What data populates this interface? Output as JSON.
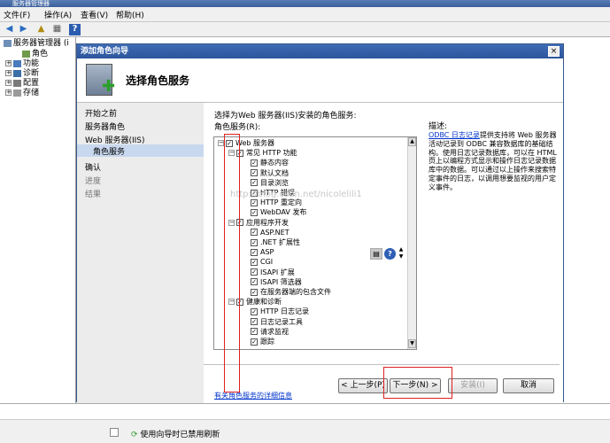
{
  "window": {
    "title": "服务器管理器"
  },
  "menu": [
    "文件(F)",
    "操作(A)",
    "查看(V)",
    "帮助(H)"
  ],
  "left_tree": {
    "root": "服务器管理器 (i",
    "items": [
      "角色",
      "功能",
      "诊断",
      "配置",
      "存储"
    ]
  },
  "dialog": {
    "title": "添加角色向导",
    "close": "×",
    "header": "选择角色服务",
    "nav": [
      "开始之前",
      "服务器角色",
      "Web 服务器(IIS)",
      "角色服务",
      "确认",
      "进度",
      "结果"
    ],
    "instruction": "选择为Web 服务器(IIS)安装的角色服务:",
    "tree_label": "角色服务(R):",
    "tree": [
      {
        "label": "Web 服务器",
        "level": 0,
        "expand": "⊟"
      },
      {
        "label": "常见 HTTP 功能",
        "level": 1,
        "expand": "⊟"
      },
      {
        "label": "静态内容",
        "level": 2
      },
      {
        "label": "默认文档",
        "level": 2
      },
      {
        "label": "目录浏览",
        "level": 2
      },
      {
        "label": "HTTP 错误",
        "level": 2
      },
      {
        "label": "HTTP 重定向",
        "level": 2
      },
      {
        "label": "WebDAV 发布",
        "level": 2
      },
      {
        "label": "应用程序开发",
        "level": 1,
        "expand": "⊟"
      },
      {
        "label": "ASP.NET",
        "level": 2
      },
      {
        "label": ".NET 扩展性",
        "level": 2
      },
      {
        "label": "ASP",
        "level": 2
      },
      {
        "label": "CGI",
        "level": 2
      },
      {
        "label": "ISAPI 扩展",
        "level": 2
      },
      {
        "label": "ISAPI 筛选器",
        "level": 2
      },
      {
        "label": "在服务器端的包含文件",
        "level": 2
      },
      {
        "label": "健康和诊断",
        "level": 1,
        "expand": "⊟"
      },
      {
        "label": "HTTP 日志记录",
        "level": 2
      },
      {
        "label": "日志记录工具",
        "level": 2
      },
      {
        "label": "请求监视",
        "level": 2
      },
      {
        "label": "跟踪",
        "level": 2
      }
    ],
    "checkmark": "✓",
    "watermark": "http://blog.csdn.net/nicolelili1",
    "desc_title": "描述:",
    "desc_link": "ODBC 日志记录",
    "desc_text": "提供支持将 Web 服务器活动记录到 ODBC 兼容数据库的基础结构。使用日志记录数据库，可以在 HTML 页上以编程方式显示和操作日志记录数据库中的数据。可以通过以上操作来搜索特定事件的日志，以调用想要监视的用户定义事件。",
    "more_link": "有关角色服务的详细信息",
    "buttons": {
      "prev": "< 上一步(P)",
      "next": "下一步(N) >",
      "install": "安装(I)",
      "cancel": "取消"
    }
  },
  "status": {
    "text": "使用向导时已禁用刷新"
  }
}
